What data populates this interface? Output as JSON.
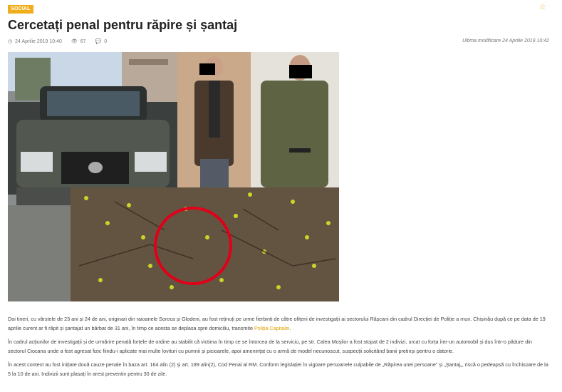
{
  "article": {
    "category": "SOCIAL",
    "title": "Cercetați penal pentru răpire și șantaj",
    "date": "24 Aprilie 2019 10:40",
    "views": "67",
    "comments": "0",
    "modified": "Ultima modificare 24 Aprilie 2019 10:42",
    "p1_before": "Doi tineri, cu  vârstele de 23 ani și 24 de ani, originari din raioanele Soroca și Glodeni, au fost reținuți pe urme fierbinți de către ofițerii de investigații ai sectorului Râșcani din cadrul Direcției de Poliție a mun. Chișinău după ce pe data de 19 aprilie curent ar fi răpit și șantajat un bărbat de 31 ani, în timp ce acesta se deplasa spre domiciliu, transmite ",
    "p1_link": "Poliția Capitalei",
    "p1_after": ".",
    "p2": "În cadrul acțiunilor de investigații și de urmărire penală forțele de ordine au stabilit că victima în timp ce se întorcea de la serviciu, pe str. Calea Moșilor a fost stopat de 2 indivizi, urcat cu forța într-un automobil și dus într-o pădure din sectorul Ciocana unde a fost agresat fizic fiindu-i aplicate mai multe lovituri cu pumnii și picioarele, apoi amenințat cu o armă de model necunoscut,  suspecții solicitând banii pretinși pentru o datorie.",
    "p3": "În acest context au fost inițiate două cauze penale în baza art. 164 alin (2) și art. 189 alin(2), Cod Penal al RM. Conform legislației în vigoare persoanele culpabile de „Răpirea unei persoane” și „Șantaj„, riscă o pedeapsă cu închisoare de la 5 la 10 de ani. Indivizii sunt plasați în arest preventiv  pentru 30 de zile."
  },
  "icons": {
    "star": "star-icon",
    "clock": "clock-icon",
    "eye": "eye-icon",
    "comment": "comment-icon"
  },
  "colors": {
    "accent": "#f0ad1b",
    "link": "#e0a100",
    "circle": "#e0001a"
  }
}
